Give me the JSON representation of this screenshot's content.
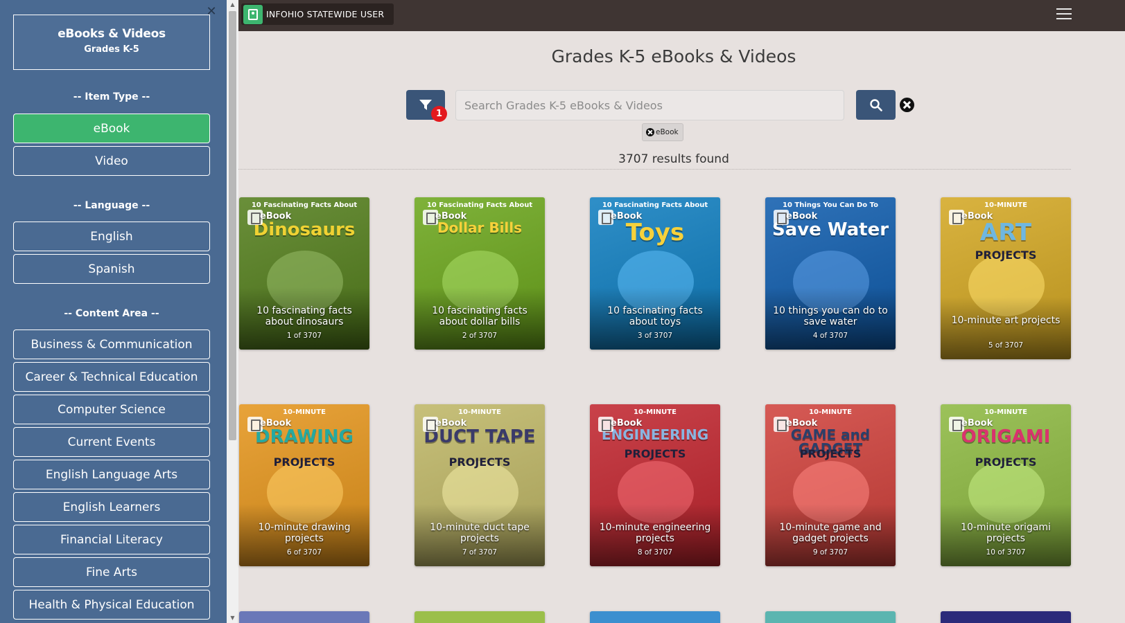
{
  "sidebar": {
    "header_title": "eBooks & Videos",
    "header_subtitle": "Grades K-5",
    "sections": {
      "item_type": "-- Item Type --",
      "language": "-- Language --",
      "content_area": "-- Content Area --"
    },
    "item_types": [
      "eBook",
      "Video"
    ],
    "languages": [
      "English",
      "Spanish"
    ],
    "content_areas": [
      "Business & Communication",
      "Career & Technical Education",
      "Computer Science",
      "Current Events",
      "English Language Arts",
      "English Learners",
      "Financial Literacy",
      "Fine Arts",
      "Health & Physical Education"
    ],
    "close_icon": "close-icon"
  },
  "topbar": {
    "user_label": "INFOHIO STATEWIDE USER",
    "user_icon": "user-card-icon",
    "menu_icon": "hamburger-menu-icon"
  },
  "main": {
    "title": "Grades K-5 eBooks & Videos",
    "search_placeholder": "Search Grades K-5 eBooks & Videos",
    "filter_count": "1",
    "active_filter_chip": "eBook",
    "results_text": "3707 results found"
  },
  "colors": {
    "sidebar_bg": "#4a6a92",
    "active_green": "#3db56f",
    "topbar_bg": "#3f3533",
    "accent_button": "#3a5578",
    "badge_red": "#e3191e",
    "page_bg": "#e7e1df"
  },
  "books": [
    {
      "cover_top": "10 Fascinating Facts About",
      "cover_title": "Dinosaurs",
      "caption": "10 fascinating facts about dinosaurs",
      "position": "1 of 3707",
      "type": "eBook",
      "bg": "#6a8f3a",
      "title_color": "#f0d233"
    },
    {
      "cover_top": "10 Fascinating Facts About",
      "cover_title": "Dollar Bills",
      "caption": "10 fascinating facts about dollar bills",
      "position": "2 of 3707",
      "type": "eBook",
      "bg": "#7fb23a",
      "title_color": "#f6d13b"
    },
    {
      "cover_top": "10 Fascinating Facts About",
      "cover_title": "Toys",
      "caption": "10 fascinating facts about toys",
      "position": "3 of 3707",
      "type": "eBook",
      "bg": "#2f8fc8",
      "title_color": "#f6d13b"
    },
    {
      "cover_top": "10 Things You Can Do To",
      "cover_title": "Save Water",
      "caption": "10 things you can do to save water",
      "position": "4 of 3707",
      "type": "eBook",
      "bg": "#2f72b8",
      "title_color": "#ffffff"
    },
    {
      "cover_top": "10-MINUTE",
      "cover_title": "ART",
      "cover_bottom": "PROJECTS",
      "caption": "10-minute art projects",
      "position": "5 of 3707",
      "type": "eBook",
      "bg": "#d9b340",
      "title_color": "#6fb7e0"
    },
    {
      "cover_top": "10-MINUTE",
      "cover_title": "DRAWING",
      "cover_bottom": "PROJECTS",
      "caption": "10-minute drawing projects",
      "position": "6 of 3707",
      "type": "eBook",
      "bg": "#e8a33a",
      "title_color": "#26a9a0"
    },
    {
      "cover_top": "10-MINUTE",
      "cover_title": "DUCT TAPE",
      "cover_bottom": "PROJECTS",
      "caption": "10-minute duct tape projects",
      "position": "7 of 3707",
      "type": "eBook",
      "bg": "#c7c07a",
      "title_color": "#3a3a6a"
    },
    {
      "cover_top": "10-MINUTE",
      "cover_title": "ENGINEERING",
      "cover_bottom": "PROJECTS",
      "caption": "10-minute engineering projects",
      "position": "8 of 3707",
      "type": "eBook",
      "bg": "#c9424a",
      "title_color": "#8ab5e0"
    },
    {
      "cover_top": "10-MINUTE",
      "cover_title": "GAME and GADGET",
      "cover_bottom": "PROJECTS",
      "caption": "10-minute game and gadget projects",
      "position": "9 of 3707",
      "type": "eBook",
      "bg": "#d65a55",
      "title_color": "#2c3f6a"
    },
    {
      "cover_top": "10-MINUTE",
      "cover_title": "ORIGAMI",
      "cover_bottom": "PROJECTS",
      "caption": "10-minute origami projects",
      "position": "10 of 3707",
      "type": "eBook",
      "bg": "#9cc25a",
      "title_color": "#d9336e"
    }
  ],
  "partial_row_colors": [
    "#6a78b8",
    "#9bbf4a",
    "#3c8fcf",
    "#5bb5b0",
    "#2b2a7a"
  ]
}
